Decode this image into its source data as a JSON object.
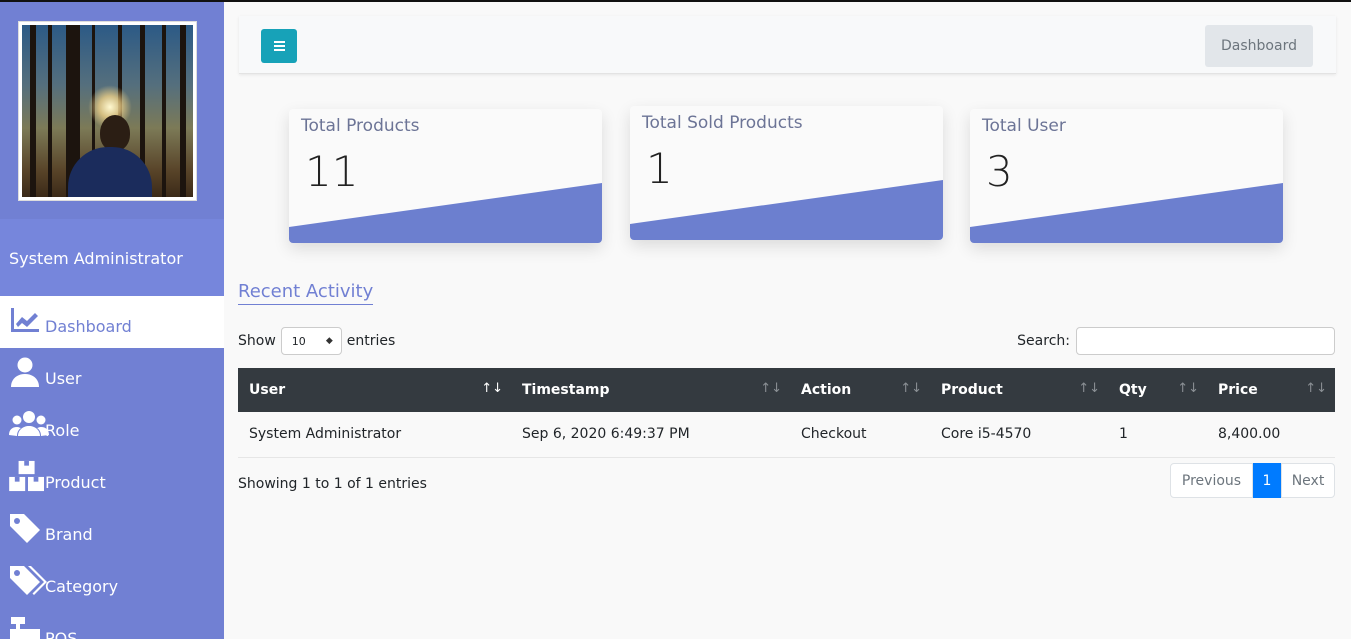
{
  "sidebar": {
    "user_name": "System Administrator",
    "items": [
      {
        "label": "Dashboard",
        "icon": "chart-line-icon",
        "active": true
      },
      {
        "label": "User",
        "icon": "user-icon"
      },
      {
        "label": "Role",
        "icon": "users-icon"
      },
      {
        "label": "Product",
        "icon": "boxes-icon"
      },
      {
        "label": "Brand",
        "icon": "tag-icon"
      },
      {
        "label": "Category",
        "icon": "tags-icon"
      },
      {
        "label": "POS",
        "icon": "cash-register-icon"
      }
    ]
  },
  "header": {
    "menu_icon": "bars-icon",
    "breadcrumb": "Dashboard"
  },
  "stats": [
    {
      "title": "Total Products",
      "value": "11"
    },
    {
      "title": "Total Sold Products",
      "value": "1"
    },
    {
      "title": "Total User",
      "value": "3"
    }
  ],
  "activity": {
    "title": "Recent Activity",
    "show_label": "Show",
    "entries_label": "entries",
    "page_size": "10",
    "search_label": "Search:",
    "columns": [
      "User",
      "Timestamp",
      "Action",
      "Product",
      "Qty",
      "Price"
    ],
    "rows": [
      [
        "System Administrator",
        "Sep 6, 2020 6:49:37 PM",
        "Checkout",
        "Core i5-4570",
        "1",
        "8,400.00"
      ]
    ],
    "info": "Showing 1 to 1 of 1 entries",
    "pagination": {
      "previous": "Previous",
      "current": "1",
      "next": "Next"
    }
  },
  "colors": {
    "sidebar": "#7180d3",
    "accent": "#6c7fcf",
    "table_header": "#343a40",
    "menu_button": "#17a2b8",
    "page_active": "#007bff"
  }
}
